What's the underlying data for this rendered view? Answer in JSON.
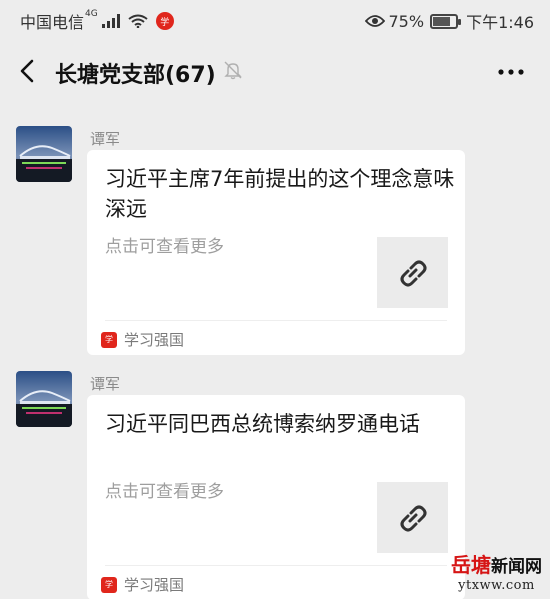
{
  "status_bar": {
    "carrier": "中国电信",
    "network": "4G",
    "battery_percent": "75%",
    "battery_level": 0.75,
    "time": "下午1:46",
    "icons": [
      "signal-icon",
      "wifi-icon",
      "xuexi-notification-icon",
      "eye-icon",
      "battery-icon"
    ]
  },
  "header": {
    "title": "长塘党支部(67)",
    "icons": [
      "back-arrow-icon",
      "mute-bell-icon",
      "more-options-icon"
    ]
  },
  "messages": [
    {
      "sender": "谭军",
      "title": "习近平主席7年前提出的这个理念意味深远",
      "description": "点击可查看更多",
      "thumbnail_icon": "link-icon",
      "source": "学习强国"
    },
    {
      "sender": "谭军",
      "title": "习近平同巴西总统博索纳罗通电话",
      "description": "点击可查看更多",
      "thumbnail_icon": "link-icon",
      "source": "学习强国"
    }
  ],
  "watermark": {
    "logo": "岳塘",
    "name": "新闻网",
    "url": "ytxww.com"
  },
  "colors": {
    "background": "#ededed",
    "card": "#ffffff",
    "accent_red": "#e0261c",
    "watermark_red": "#d61515",
    "muted_text": "#9e9e9e"
  }
}
